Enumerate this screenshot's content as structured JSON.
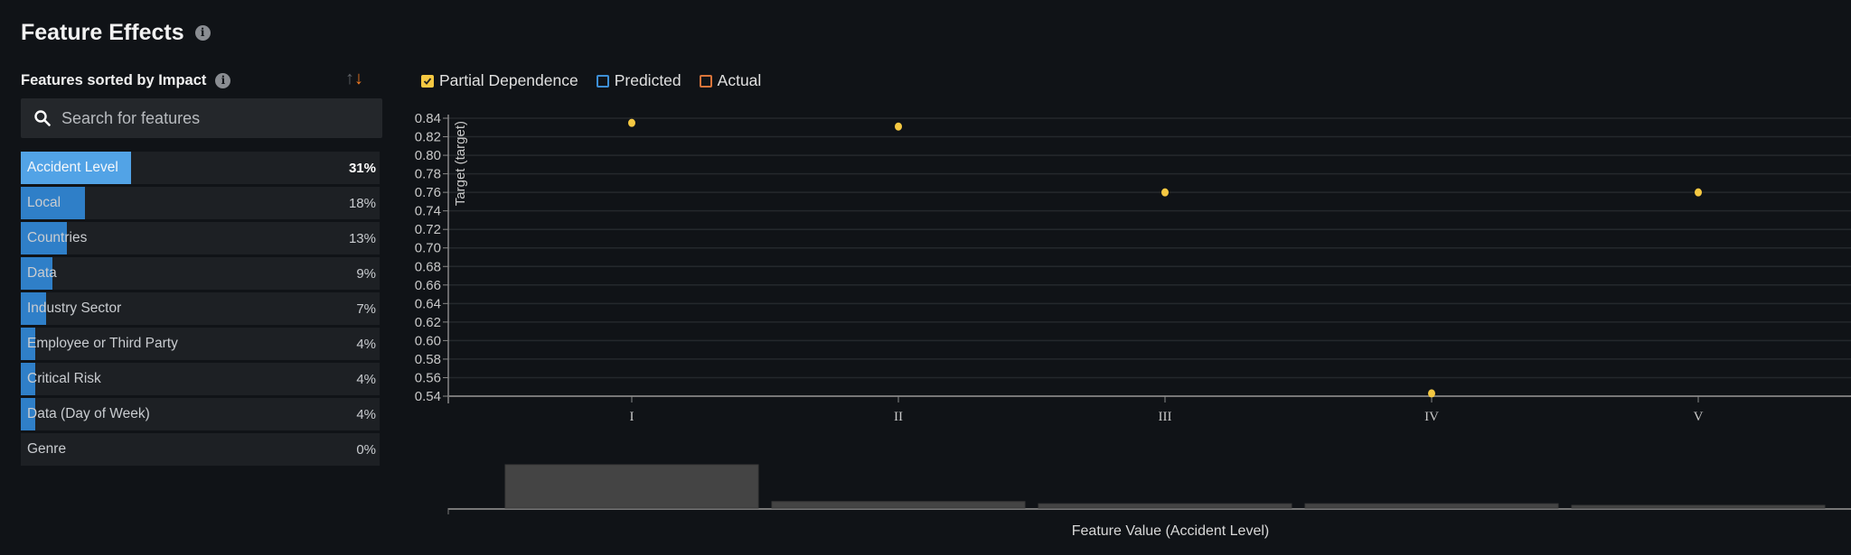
{
  "header": {
    "title": "Feature Effects",
    "info_icon": "info-icon"
  },
  "sidebar": {
    "heading": "Features sorted by Impact",
    "sort_up_icon": "arrow-up-icon",
    "sort_down_icon": "arrow-down-icon",
    "search": {
      "placeholder": "Search for features",
      "value": ""
    },
    "features": [
      {
        "name": "Accident Level",
        "impact": "31%",
        "value": 31,
        "selected": true
      },
      {
        "name": "Local",
        "impact": "18%",
        "value": 18
      },
      {
        "name": "Countries",
        "impact": "13%",
        "value": 13
      },
      {
        "name": "Data",
        "impact": "9%",
        "value": 9
      },
      {
        "name": "Industry Sector",
        "impact": "7%",
        "value": 7
      },
      {
        "name": "Employee or Third Party",
        "impact": "4%",
        "value": 4
      },
      {
        "name": "Critical Risk",
        "impact": "4%",
        "value": 4
      },
      {
        "name": "Data (Day of Week)",
        "impact": "4%",
        "value": 4
      },
      {
        "name": "Genre",
        "impact": "0%",
        "value": 0
      }
    ]
  },
  "legend": [
    {
      "label": "Partial Dependence",
      "color": "#f5c842",
      "checked": true
    },
    {
      "label": "Predicted",
      "color": "#3d8fd6",
      "checked": false
    },
    {
      "label": "Actual",
      "color": "#d9743a",
      "checked": false
    }
  ],
  "chart_data": {
    "type": "scatter",
    "xlabel": "Feature Value (Accident Level)",
    "ylabel": "Target (target)",
    "categories": [
      "I",
      "II",
      "III",
      "IV",
      "V"
    ],
    "ylim": [
      0.54,
      0.84
    ],
    "yticks": [
      "0.84",
      "0.82",
      "0.80",
      "0.78",
      "0.76",
      "0.74",
      "0.72",
      "0.70",
      "0.68",
      "0.66",
      "0.64",
      "0.62",
      "0.60",
      "0.58",
      "0.56",
      "0.54"
    ],
    "grid": true,
    "series": [
      {
        "name": "Partial Dependence",
        "color": "#f5c842",
        "values": [
          0.835,
          0.831,
          0.76,
          0.543,
          0.76
        ]
      }
    ],
    "histogram": {
      "color": "#444444",
      "relative_frequency": [
        1.0,
        0.15,
        0.1,
        0.1,
        0.05
      ]
    }
  }
}
